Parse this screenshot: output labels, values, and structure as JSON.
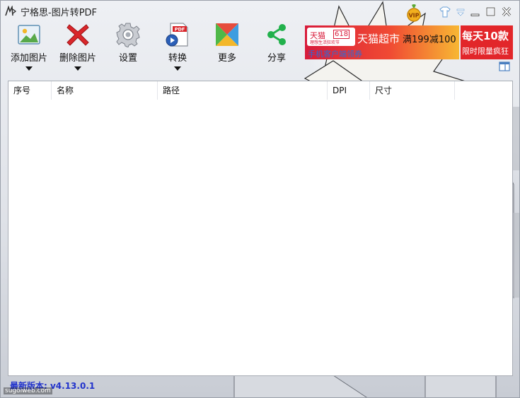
{
  "window": {
    "title": "宁格思-图片转PDF",
    "controls": [
      "skin-icon",
      "menu-icon",
      "minimize-icon",
      "maximize-icon",
      "close-icon"
    ]
  },
  "toolbar": {
    "add_label": "添加图片",
    "delete_label": "删除图片",
    "settings_label": "设置",
    "convert_label": "转换",
    "convert_badge": "PDF",
    "more_label": "更多",
    "share_label": "分享"
  },
  "ad": {
    "brand": "天猫",
    "badge": "618",
    "slogan": "理想生活狂欢节",
    "title": "天猫超市",
    "promo": "满199减100",
    "subtitle": "手机客户端领券",
    "right_title": "每天10款",
    "right_sub": "限时限量疯狂"
  },
  "table": {
    "columns": [
      "序号",
      "名称",
      "路径",
      "DPI",
      "尺寸"
    ],
    "rows": []
  },
  "footer": {
    "version": "最新版本: v4.13.0.1",
    "watermark": "sugoiweb.com"
  },
  "colors": {
    "accent_blue": "#2233cc",
    "ad_red": "#e2262a",
    "share_green": "#22b14c",
    "delete_red": "#d9262b"
  }
}
